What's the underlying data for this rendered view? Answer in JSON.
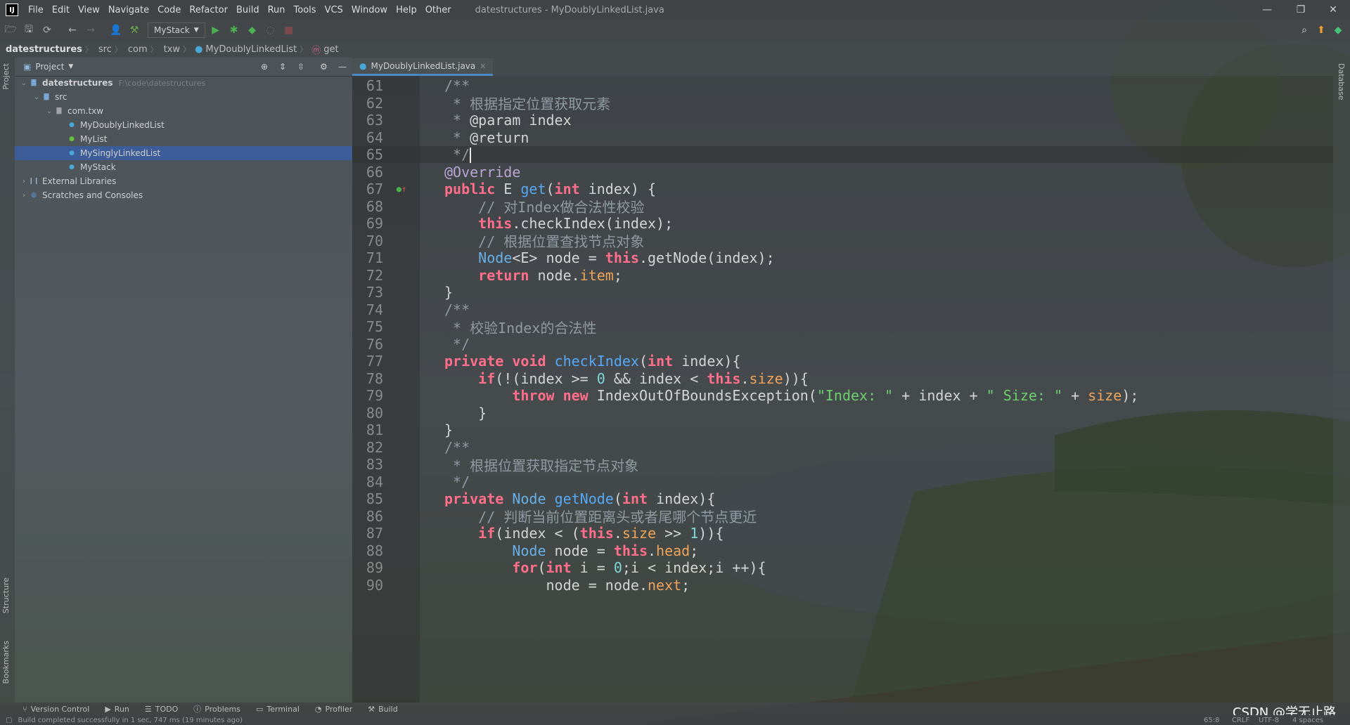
{
  "menubar": {
    "logo": "IJ",
    "items": [
      "File",
      "Edit",
      "View",
      "Navigate",
      "Code",
      "Refactor",
      "Build",
      "Run",
      "Tools",
      "VCS",
      "Window",
      "Help",
      "Other"
    ],
    "window_title": "datestructures - MyDoublyLinkedList.java",
    "controls": [
      "—",
      "❐",
      "✕"
    ]
  },
  "toolbar": {
    "run_config": "MyStack"
  },
  "breadcrumb": {
    "items": [
      "datestructures",
      "src",
      "com",
      "txw",
      "MyDoublyLinkedList",
      "get"
    ]
  },
  "left_stripe": {
    "top_tab": "Project",
    "structure_tab": "Structure",
    "bookmarks_tab": "Bookmarks"
  },
  "project_panel": {
    "header": "Project",
    "tree": [
      {
        "label": "datestructures",
        "hint": "F:\\code\\datestructures",
        "icon": "folder-icon",
        "level": 0,
        "expanded": true,
        "bold": true
      },
      {
        "label": "src",
        "icon": "folder-icon",
        "level": 1,
        "expanded": true
      },
      {
        "label": "com.txw",
        "icon": "package-icon",
        "level": 2,
        "expanded": true
      },
      {
        "label": "MyDoublyLinkedList",
        "icon": "class-icon",
        "level": 3
      },
      {
        "label": "MyList",
        "icon": "interface-icon",
        "level": 3
      },
      {
        "label": "MySinglyLinkedList",
        "icon": "class-icon",
        "level": 3,
        "selected": true
      },
      {
        "label": "MyStack",
        "icon": "class-icon",
        "level": 3
      },
      {
        "label": "External Libraries",
        "icon": "library-icon",
        "level": 0,
        "expanded": false
      },
      {
        "label": "Scratches and Consoles",
        "icon": "scratch-icon",
        "level": 0,
        "expanded": false
      }
    ]
  },
  "editor": {
    "tab_label": "MyDoublyLinkedList.java",
    "lines": [
      {
        "n": "61",
        "html": "<span class='cm'>/**</span>"
      },
      {
        "n": "62",
        "html": "<span class='cm'> * 根据指定位置获取元素</span>"
      },
      {
        "n": "63",
        "html": "<span class='cm'> * </span><span class='an' style='color:#d4d4d4'>@param</span> <span class='cm' style='color:#d4d4d4'>index</span>"
      },
      {
        "n": "64",
        "html": "<span class='cm'> * </span><span style='color:#d4d4d4'>@return</span>"
      },
      {
        "n": "65",
        "html": "<span class='cm'> */</span><span class='caret'></span>",
        "current": true
      },
      {
        "n": "66",
        "html": "<span class='an'>@Override</span>"
      },
      {
        "n": "67",
        "html": "<span class='kw'>public</span> E <span class='fn'>get</span>(<span class='kw'>int</span> index) {"
      },
      {
        "n": "68",
        "html": "    <span class='cm'>// 对Index做合法性校验</span>"
      },
      {
        "n": "69",
        "html": "    <span class='kw'>this</span>.checkIndex(index);"
      },
      {
        "n": "70",
        "html": "    <span class='cm'>// 根据位置查找节点对象</span>"
      },
      {
        "n": "71",
        "html": "    <span class='ty'>Node</span>&lt;E&gt; node = <span class='kw'>this</span>.getNode(index);"
      },
      {
        "n": "72",
        "html": "    <span class='kw'>return</span> node.<span class='fld'>item</span>;"
      },
      {
        "n": "73",
        "html": "}"
      },
      {
        "n": "74",
        "html": "<span class='cm'>/**</span>"
      },
      {
        "n": "75",
        "html": "<span class='cm'> * 校验Index的合法性</span>"
      },
      {
        "n": "76",
        "html": "<span class='cm'> */</span>"
      },
      {
        "n": "77",
        "html": "<span class='kw'>private</span> <span class='kw'>void</span> <span class='fn'>checkIndex</span>(<span class='kw'>int</span> index){"
      },
      {
        "n": "78",
        "html": "    <span class='kw'>if</span>(!(index &gt;= <span class='num'>0</span> &amp;&amp; index &lt; <span class='kw'>this</span>.<span class='fld'>size</span>)){"
      },
      {
        "n": "79",
        "html": "        <span class='kw'>throw</span> <span class='kw'>new</span> IndexOutOfBoundsException(<span class='str'>\"Index: \"</span> + index + <span class='str'>\" Size: \"</span> + <span class='fld'>size</span>);"
      },
      {
        "n": "80",
        "html": "    }"
      },
      {
        "n": "81",
        "html": "}"
      },
      {
        "n": "82",
        "html": "<span class='cm'>/**</span>"
      },
      {
        "n": "83",
        "html": "<span class='cm'> * 根据位置获取指定节点对象</span>"
      },
      {
        "n": "84",
        "html": "<span class='cm'> */</span>"
      },
      {
        "n": "85",
        "html": "<span class='kw'>private</span> <span class='ty'>Node</span> <span class='fn'>getNode</span>(<span class='kw'>int</span> index){"
      },
      {
        "n": "86",
        "html": "    <span class='cm'>// 判断当前位置距离头或者尾哪个节点更近</span>"
      },
      {
        "n": "87",
        "html": "    <span class='kw'>if</span>(index &lt; (<span class='kw'>this</span>.<span class='fld'>size</span> &gt;&gt; <span class='num'>1</span>)){"
      },
      {
        "n": "88",
        "html": "        <span class='ty'>Node</span> node = <span class='kw'>this</span>.<span class='fld'>head</span>;"
      },
      {
        "n": "89",
        "html": "        <span class='kw'>for</span>(<span class='kw'>int</span> i = <span class='num'>0</span>;i &lt; index;i ++){"
      },
      {
        "n": "90",
        "html": "            node = node.<span class='fld'>next</span>;"
      }
    ]
  },
  "right_stripe": {
    "database_tab": "Database"
  },
  "bottom_bar": {
    "items": [
      "Version Control",
      "Run",
      "TODO",
      "Problems",
      "Terminal",
      "Profiler",
      "Build"
    ]
  },
  "status_bar": {
    "message": "Build completed successfully in 1 sec, 747 ms (19 minutes ago)",
    "position": "65:8",
    "line_sep": "CRLF",
    "encoding": "UTF-8",
    "indent": "4 spaces"
  },
  "watermark": "CSDN @学无止路"
}
